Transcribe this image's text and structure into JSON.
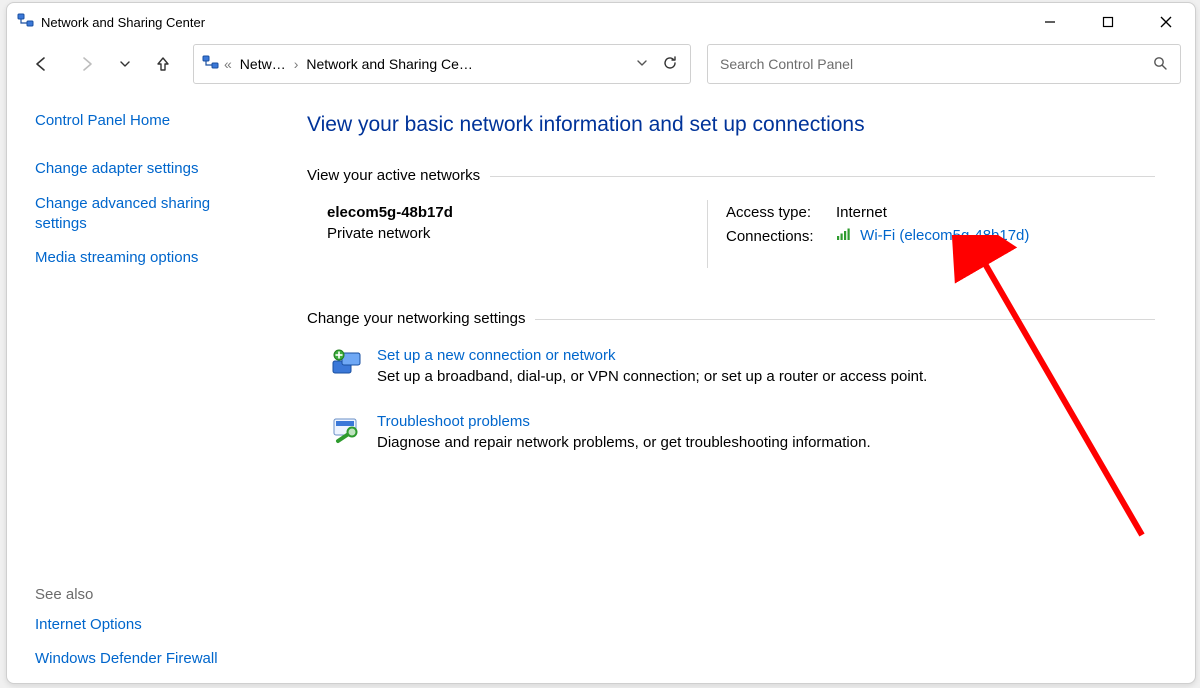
{
  "window": {
    "title": "Network and Sharing Center"
  },
  "address": {
    "crumb1": "Netw…",
    "crumb2": "Network and Sharing Ce…"
  },
  "search": {
    "placeholder": "Search Control Panel"
  },
  "sidebar": {
    "home": "Control Panel Home",
    "links": [
      "Change adapter settings",
      "Change advanced sharing settings",
      "Media streaming options"
    ],
    "see_also_label": "See also",
    "see_also": [
      "Internet Options",
      "Windows Defender Firewall"
    ]
  },
  "main": {
    "title": "View your basic network information and set up connections",
    "active_section": "View your active networks",
    "network": {
      "name": "elecom5g-48b17d",
      "type": "Private network",
      "access_label": "Access type:",
      "access_value": "Internet",
      "connections_label": "Connections:",
      "connections_value": "Wi-Fi (elecom5g-48b17d)"
    },
    "change_section": "Change your networking settings",
    "items": [
      {
        "title": "Set up a new connection or network",
        "desc": "Set up a broadband, dial-up, or VPN connection; or set up a router or access point."
      },
      {
        "title": "Troubleshoot problems",
        "desc": "Diagnose and repair network problems, or get troubleshooting information."
      }
    ]
  }
}
